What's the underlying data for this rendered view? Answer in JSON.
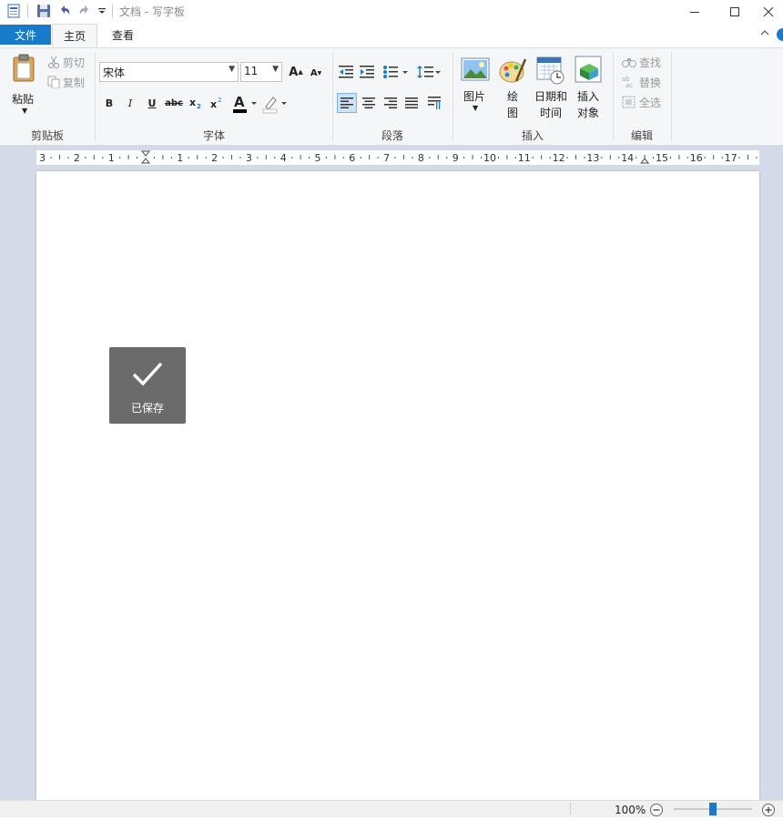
{
  "app": {
    "title": "文档 - 写字板"
  },
  "tabs": {
    "file": "文件",
    "home": "主页",
    "view": "查看"
  },
  "clipboard": {
    "paste": "粘贴",
    "cut": "剪切",
    "copy": "复制",
    "group_label": "剪贴板"
  },
  "font": {
    "family": "宋体",
    "size": "11",
    "group_label": "字体",
    "bold": "B",
    "italic": "I",
    "underline": "U",
    "strike": "abc"
  },
  "paragraph": {
    "group_label": "段落"
  },
  "insert": {
    "picture": "图片",
    "paint_1": "绘",
    "paint_2": "图",
    "datetime_1": "日期和",
    "datetime_2": "时间",
    "object_1": "插入",
    "object_2": "对象",
    "group_label": "插入"
  },
  "editing": {
    "find": "查找",
    "replace": "替换",
    "select_all": "全选",
    "group_label": "编辑"
  },
  "ruler": {
    "labels": [
      "3",
      "2",
      "1",
      "1",
      "2",
      "3",
      "4",
      "5",
      "6",
      "7",
      "8",
      "9",
      "10",
      "11",
      "12",
      "13",
      "14",
      "15",
      "16",
      "17"
    ]
  },
  "toast": {
    "label": "已保存"
  },
  "status": {
    "zoom": "100%",
    "zoom_level": 0.5
  },
  "colors": {
    "accent": "#1979ca",
    "ribbon_bg": "#f5f6f7",
    "workspace_bg": "#d4dae8",
    "toast_bg": "#6b6b6b"
  }
}
